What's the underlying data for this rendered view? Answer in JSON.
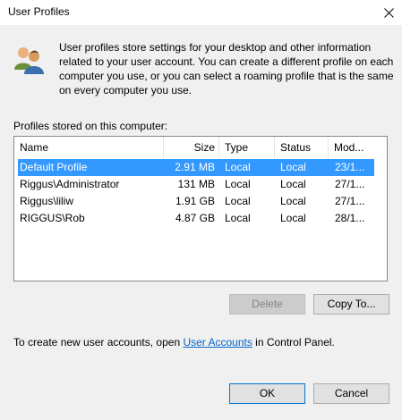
{
  "window": {
    "title": "User Profiles"
  },
  "description": "User profiles store settings for your desktop and other information related to your user account. You can create a different profile on each computer you use, or you can select a roaming profile that is the same on every computer you use.",
  "profiles_label": "Profiles stored on this computer:",
  "columns": [
    "Name",
    "Size",
    "Type",
    "Status",
    "Mod..."
  ],
  "rows": [
    {
      "name": "Default Profile",
      "size": "2.91 MB",
      "type": "Local",
      "status": "Local",
      "modified": "23/1..."
    },
    {
      "name": "Riggus\\Administrator",
      "size": "131 MB",
      "type": "Local",
      "status": "Local",
      "modified": "27/1..."
    },
    {
      "name": "Riggus\\liliw",
      "size": "1.91 GB",
      "type": "Local",
      "status": "Local",
      "modified": "27/1..."
    },
    {
      "name": "RIGGUS\\Rob",
      "size": "4.87 GB",
      "type": "Local",
      "status": "Local",
      "modified": "28/1..."
    }
  ],
  "buttons": {
    "delete": "Delete",
    "copy_to": "Copy To...",
    "ok": "OK",
    "cancel": "Cancel"
  },
  "hint": {
    "before": "To create new user accounts, open ",
    "link": "User Accounts",
    "after": " in Control Panel."
  },
  "colors": {
    "selection": "#3399ff",
    "link": "#0066cc",
    "default_button_border": "#0078d7"
  }
}
